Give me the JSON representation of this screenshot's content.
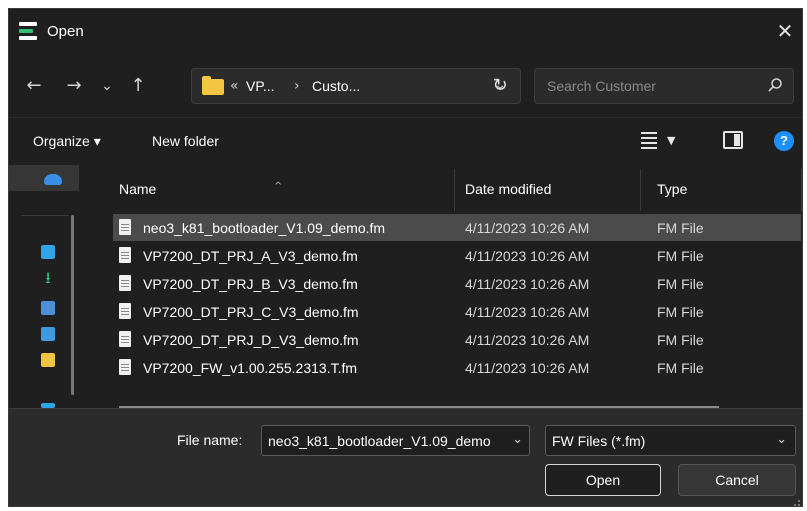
{
  "window": {
    "title": "Open",
    "close_glyph": "✕"
  },
  "nav": {
    "back": "←",
    "forward": "→",
    "history": "⌄",
    "up": "↑",
    "breadcrumb_prefix": "«",
    "breadcrumb": [
      "VP...",
      "Custo..."
    ],
    "breadcrumb_sep": "›",
    "address_drop": "⌄",
    "refresh": "↻",
    "search_placeholder": "Search Customer"
  },
  "commands": {
    "organize": "Organize ▾",
    "new_folder": "New folder",
    "view_drop": "▼",
    "help": "?"
  },
  "columns": {
    "name": "Name",
    "date": "Date modified",
    "type": "Type",
    "sort_glyph": "^"
  },
  "files": [
    {
      "name": "neo3_k81_bootloader_V1.09_demo.fm",
      "date": "4/11/2023 10:26 AM",
      "type": "FM File",
      "selected": true
    },
    {
      "name": "VP7200_DT_PRJ_A_V3_demo.fm",
      "date": "4/11/2023 10:26 AM",
      "type": "FM File"
    },
    {
      "name": "VP7200_DT_PRJ_B_V3_demo.fm",
      "date": "4/11/2023 10:26 AM",
      "type": "FM File"
    },
    {
      "name": "VP7200_DT_PRJ_C_V3_demo.fm",
      "date": "4/11/2023 10:26 AM",
      "type": "FM File"
    },
    {
      "name": "VP7200_DT_PRJ_D_V3_demo.fm",
      "date": "4/11/2023 10:26 AM",
      "type": "FM File"
    },
    {
      "name": "VP7200_FW_v1.00.255.2313.T.fm",
      "date": "4/11/2023 10:26 AM",
      "type": "FM File"
    }
  ],
  "footer": {
    "file_name_label": "File name:",
    "file_name_value": "neo3_k81_bootloader_V1.09_demo",
    "file_name_drop": "⌄",
    "file_type": "FW Files (*.fm)",
    "file_type_drop": "⌄",
    "open": "Open",
    "cancel": "Cancel"
  },
  "colors": {
    "window_bg": "#1f1f1f",
    "selected_row": "#4b4b4b",
    "accent": "#1e8fff",
    "folder": "#f4c542"
  }
}
